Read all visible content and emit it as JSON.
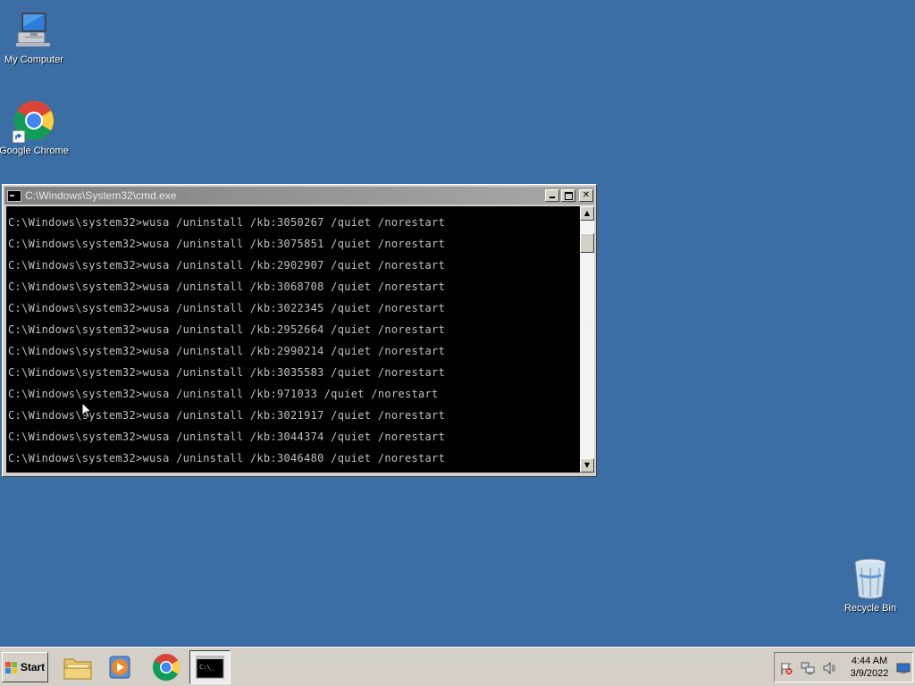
{
  "desktop": {
    "background_color": "#3a6ea5",
    "icons": [
      {
        "label": "My Computer",
        "icon": "computer-icon"
      },
      {
        "label": "Google Chrome",
        "icon": "chrome-icon"
      },
      {
        "label": "Recycle Bin",
        "icon": "recycle-bin-icon"
      }
    ]
  },
  "cmd_window": {
    "title": "C:\\Windows\\System32\\cmd.exe",
    "buttons": {
      "minimize": "minimize-icon",
      "maximize": "maximize-icon",
      "close": "✕"
    },
    "lines": [
      "C:\\Windows\\system32>wusa /uninstall /kb:3050267 /quiet /norestart",
      "C:\\Windows\\system32>wusa /uninstall /kb:3075851 /quiet /norestart",
      "C:\\Windows\\system32>wusa /uninstall /kb:2902907 /quiet /norestart",
      "C:\\Windows\\system32>wusa /uninstall /kb:3068708 /quiet /norestart",
      "C:\\Windows\\system32>wusa /uninstall /kb:3022345 /quiet /norestart",
      "C:\\Windows\\system32>wusa /uninstall /kb:2952664 /quiet /norestart",
      "C:\\Windows\\system32>wusa /uninstall /kb:2990214 /quiet /norestart",
      "C:\\Windows\\system32>wusa /uninstall /kb:3035583 /quiet /norestart",
      "C:\\Windows\\system32>wusa /uninstall /kb:971033 /quiet /norestart",
      "C:\\Windows\\system32>wusa /uninstall /kb:3021917 /quiet /norestart",
      "C:\\Windows\\system32>wusa /uninstall /kb:3044374 /quiet /norestart",
      "C:\\Windows\\system32>wusa /uninstall /kb:3046480 /quiet /norestart"
    ],
    "scrollbar": {
      "up": "▲",
      "down": "▼"
    },
    "text_color": "#c0c0c0",
    "background_color": "#000000"
  },
  "taskbar": {
    "start_label": "Start",
    "pinned": [
      {
        "name": "windows-explorer",
        "icon": "folder-icon"
      },
      {
        "name": "media-player",
        "icon": "media-player-icon"
      },
      {
        "name": "google-chrome",
        "icon": "chrome-icon"
      },
      {
        "name": "command-prompt",
        "icon": "cmd-icon",
        "active": true
      }
    ],
    "cmd_icon_text": "C:\\_"
  },
  "tray": {
    "icons": [
      "action-center-flag-icon",
      "network-icon",
      "volume-icon",
      "show-desktop-icon"
    ],
    "time": "4:44 AM",
    "date": "3/9/2022"
  }
}
